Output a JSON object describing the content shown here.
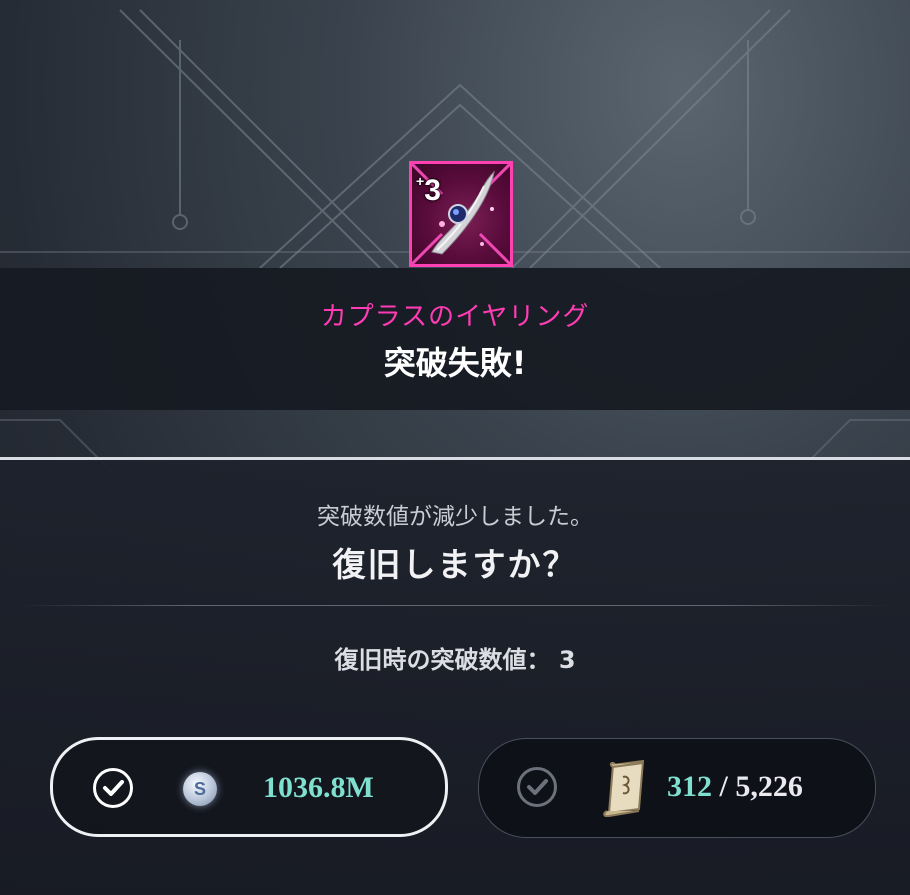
{
  "item": {
    "name": "カプラスのイヤリング",
    "level_plus": "+",
    "level": "3",
    "rarity_color": "#ff3fb4",
    "icon": "earring-icon"
  },
  "result": {
    "title": "突破失敗!"
  },
  "prompt": {
    "message": "突破数値が減少しました。",
    "question": "復旧しますか？"
  },
  "recovery": {
    "text": "復旧時の突破数値： 3"
  },
  "options": [
    {
      "selected": true,
      "currency_icon": "silver-coin-icon",
      "coin_letter": "S",
      "amount": "1036.8M"
    },
    {
      "selected": false,
      "currency_icon": "scroll-icon",
      "owned": "312",
      "separator": " / ",
      "required": "5,226"
    }
  ],
  "colors": {
    "accent_pink": "#ff3cb4",
    "value_teal": "#7fe0d0"
  }
}
